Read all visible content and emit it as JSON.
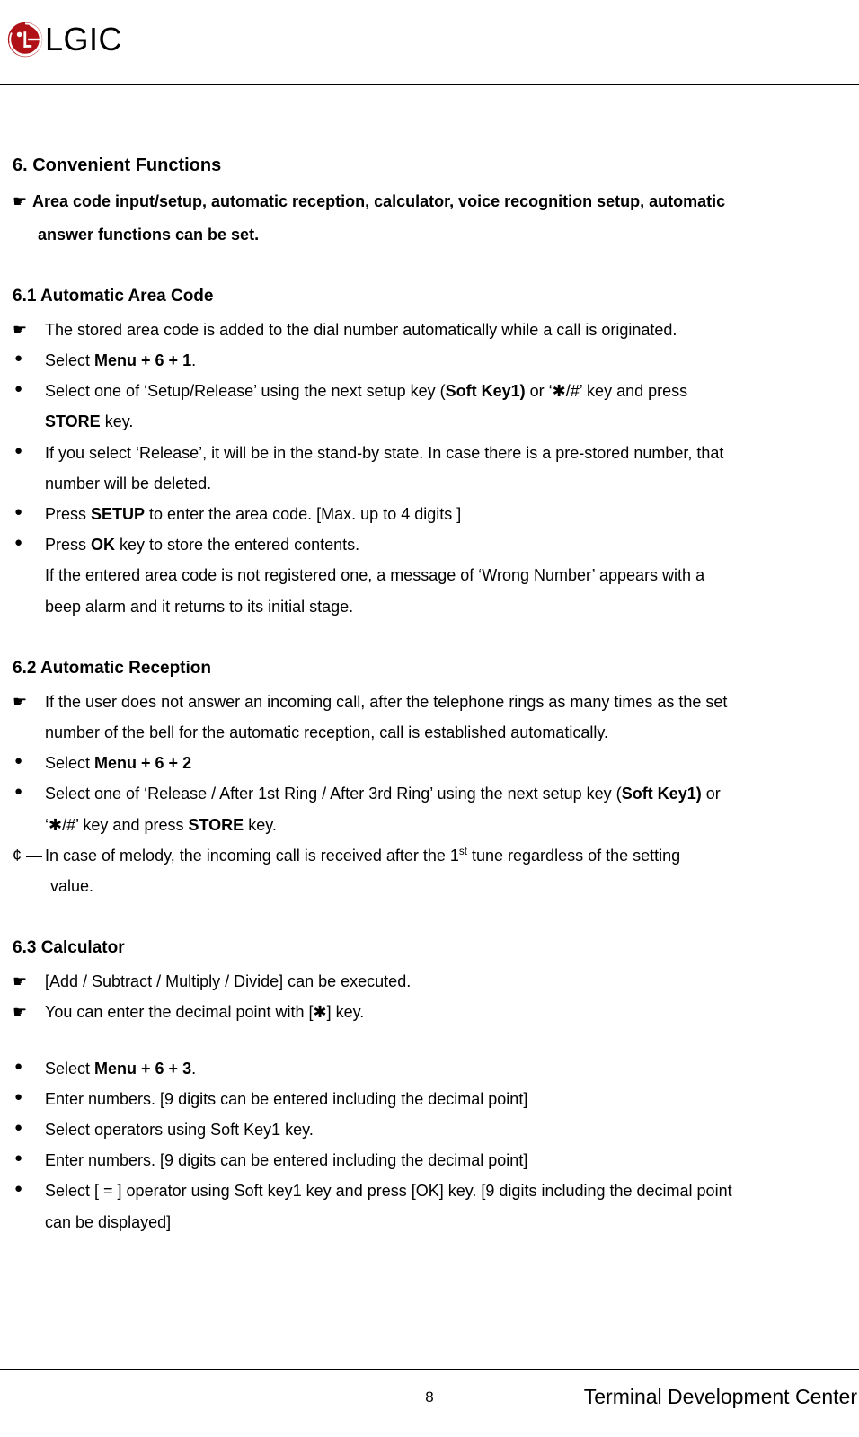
{
  "header": {
    "brand": "LGIC"
  },
  "section": {
    "title": "6. Convenient Functions",
    "intro1": "Area code input/setup, automatic reception, calculator, voice recognition setup, automatic",
    "intro2": "answer functions can be set."
  },
  "s61": {
    "title": "6.1 Automatic Area Code",
    "p1": "The stored area code is added to the dial number automatically while a call is originated.",
    "b1_pre": "Select ",
    "b1_bold": "Menu + 6 + 1",
    "b1_post": ".",
    "b2_a": "Select one of ‘Setup/Release’ using the next setup key (",
    "b2_sk": "Soft Key1)",
    "b2_b": " or ‘✱/#’ key and press",
    "b2_c_pre": "",
    "b2_store": "STORE",
    "b2_c_post": " key.",
    "b3_a": "If you select ‘Release’, it will be in the stand-by state. In case there is a pre-stored number, that",
    "b3_b": "number will be deleted.",
    "b4_pre": "Press ",
    "b4_bold": "SETUP",
    "b4_post": " to enter the area code. [Max. up to 4 digits ]",
    "b5_pre": "Press ",
    "b5_bold": "OK",
    "b5_post": " key to store the entered contents.",
    "b5_note1": "If the entered area code is not registered one, a message of ‘Wrong Number’ appears with a",
    "b5_note2": "beep alarm and it returns to its initial stage."
  },
  "s62": {
    "title": "6.2 Automatic Reception",
    "p1a": "If the user does not answer an incoming call, after the telephone rings as many times as the set",
    "p1b": "number of the bell for the automatic reception, call is established automatically.",
    "b1_pre": "Select ",
    "b1_bold": "Menu + 6 + 2",
    "b2_a": "Select one of ‘Release / After 1st Ring / After 3rd Ring’ using the next setup key (",
    "b2_sk": "Soft Key1)",
    "b2_b": " or",
    "b2_c_pre": "‘✱/#’ key and press ",
    "b2_store": "STORE",
    "b2_c_post": " key.",
    "note_a": "In case of melody, the incoming call is received after the 1",
    "note_sup": "st",
    "note_b": " tune regardless of the setting",
    "note_c": "value."
  },
  "s63": {
    "title": "6.3 Calculator",
    "p1": "[Add / Subtract / Multiply / Divide] can be executed.",
    "p2": "You can enter the decimal point with [✱] key.",
    "b1_pre": "Select ",
    "b1_bold": "Menu + 6 + 3",
    "b1_post": ".",
    "b2": "Enter numbers. [9 digits can be entered including the decimal point]",
    "b3": "Select operators using Soft Key1 key.",
    "b4": "Enter numbers. [9 digits can be entered including the decimal point]",
    "b5a": "Select [ = ] operator using Soft key1 key and press [OK] key. [9 digits including the decimal point",
    "b5b": "can be displayed]"
  },
  "footer": {
    "page": "8",
    "right": "Terminal Development Center"
  },
  "glyphs": {
    "pointer": "☛",
    "bullet": "●",
    "note": "¢ —"
  }
}
